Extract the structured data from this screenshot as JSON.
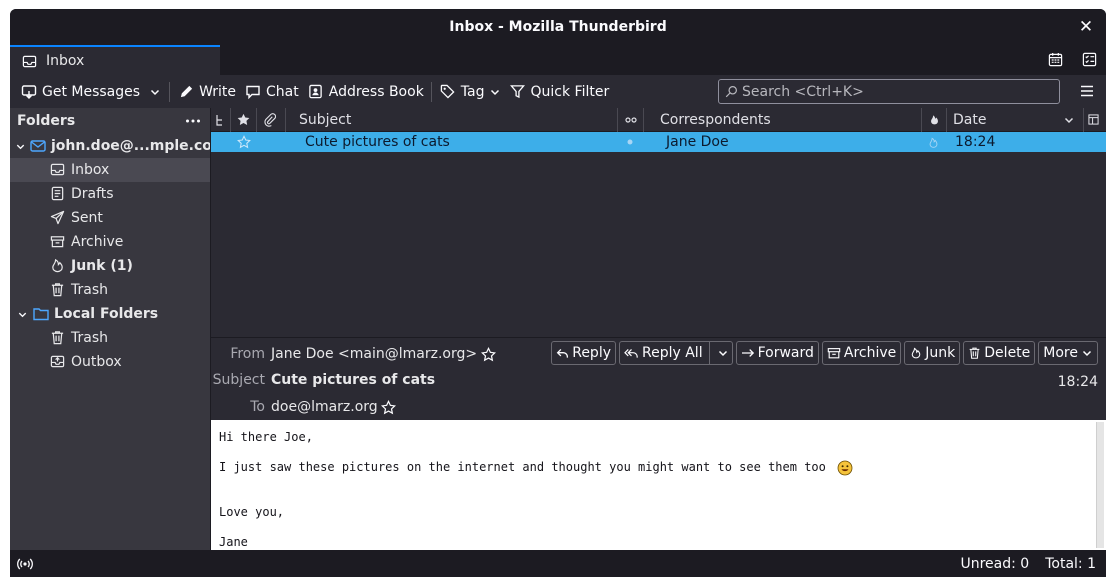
{
  "window": {
    "title": "Inbox - Mozilla Thunderbird",
    "close_glyph": "✕"
  },
  "tab": {
    "label": "Inbox"
  },
  "toolbar": {
    "get_messages": "Get Messages",
    "write": "Write",
    "chat": "Chat",
    "address_book": "Address Book",
    "tag": "Tag",
    "quick_filter": "Quick Filter",
    "search_placeholder": "Search <Ctrl+K>"
  },
  "folders": {
    "header": "Folders",
    "account": "john.doe@...mple.com",
    "items": [
      {
        "label": "Inbox",
        "icon": "inbox-icon"
      },
      {
        "label": "Drafts",
        "icon": "drafts-icon"
      },
      {
        "label": "Sent",
        "icon": "sent-icon"
      },
      {
        "label": "Archive",
        "icon": "archive-icon"
      },
      {
        "label": "Junk (1)",
        "icon": "junk-icon"
      },
      {
        "label": "Trash",
        "icon": "trash-icon"
      }
    ],
    "local": "Local Folders",
    "local_items": [
      {
        "label": "Trash",
        "icon": "trash-icon"
      },
      {
        "label": "Outbox",
        "icon": "outbox-icon"
      }
    ]
  },
  "list": {
    "columns": {
      "subject": "Subject",
      "correspondents": "Correspondents",
      "date": "Date"
    },
    "rows": [
      {
        "subject": "Cute pictures of cats",
        "correspondent": "Jane Doe",
        "date": "18:24"
      }
    ]
  },
  "message": {
    "labels": {
      "from": "From",
      "subject": "Subject",
      "to": "To"
    },
    "from": "Jane Doe <main@lmarz.org>",
    "subject": "Cute pictures of cats",
    "to": "doe@lmarz.org",
    "time": "18:24",
    "buttons": {
      "reply": "Reply",
      "reply_all": "Reply All",
      "forward": "Forward",
      "archive": "Archive",
      "junk": "Junk",
      "delete": "Delete",
      "more": "More"
    },
    "body": {
      "line1": "Hi there Joe,",
      "line2": "I just saw these pictures on the internet and thought you might want to see them too",
      "line3": "Love you,",
      "line4": "Jane"
    }
  },
  "status": {
    "unread": "Unread: 0",
    "total": "Total: 1"
  }
}
